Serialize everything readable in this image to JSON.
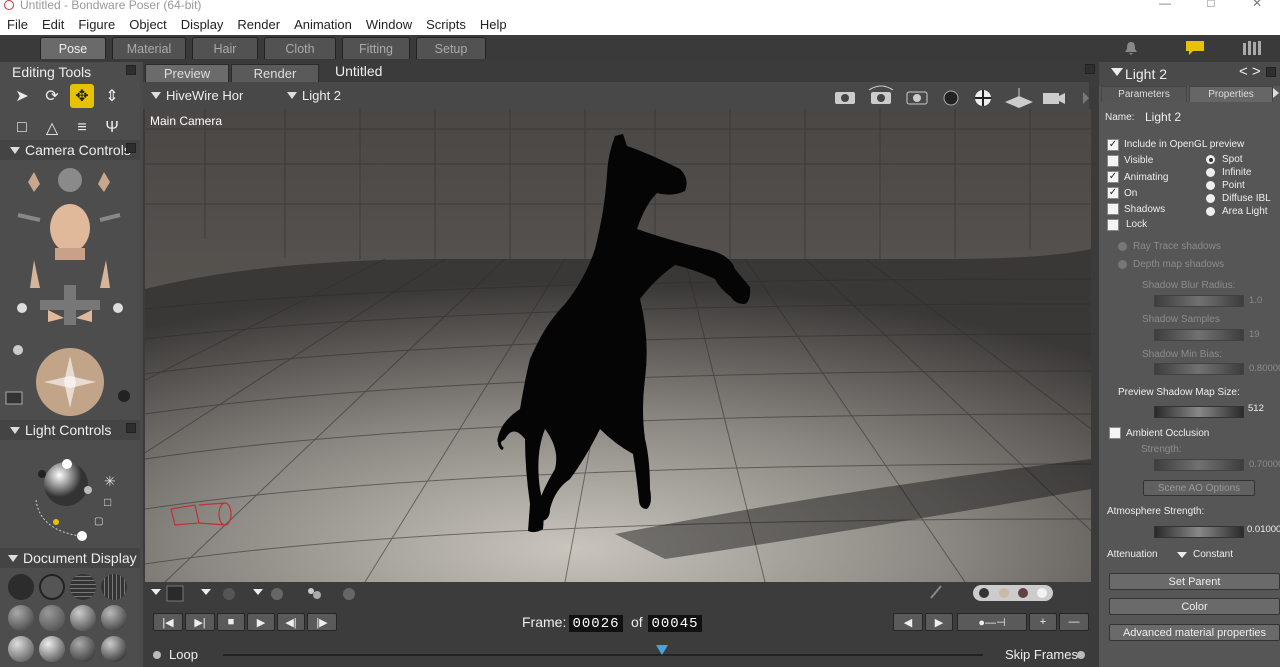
{
  "app": {
    "title": "Untitled - Bondware Poser (64-bit)"
  },
  "menu": [
    "File",
    "Edit",
    "Figure",
    "Object",
    "Display",
    "Render",
    "Animation",
    "Window",
    "Scripts",
    "Help"
  ],
  "room_tabs": [
    "Pose",
    "Material",
    "Hair",
    "Cloth",
    "Fitting",
    "Setup"
  ],
  "left": {
    "editing_tools": "Editing Tools",
    "camera_controls": "Camera Controls",
    "light_controls": "Light Controls",
    "document_display": "Document  Display"
  },
  "document": {
    "tabs": [
      "Preview",
      "Render"
    ],
    "title": "Untitled",
    "figure_select": "HiveWire Hor",
    "actor_select": "Light 2",
    "camera_label": "Main Camera"
  },
  "timeline": {
    "frame_label": "Frame:",
    "current": "00026",
    "of_label": "of",
    "total": "00045",
    "loop": "Loop",
    "skip_frames": "Skip Frames"
  },
  "right": {
    "header": "Light 2",
    "tabs": [
      "Parameters",
      "Properties"
    ],
    "name_label": "Name:",
    "name_value": "Light 2",
    "checks": [
      {
        "label": "Include in OpenGL preview",
        "checked": true
      },
      {
        "label": "Visible",
        "checked": false
      },
      {
        "label": "Animating",
        "checked": true
      },
      {
        "label": "On",
        "checked": true
      },
      {
        "label": "Shadows",
        "checked": false
      },
      {
        "label": "Lock",
        "checked": false
      }
    ],
    "types": [
      {
        "label": "Spot",
        "selected": true
      },
      {
        "label": "Infinite",
        "selected": false
      },
      {
        "label": "Point",
        "selected": false
      },
      {
        "label": "Diffuse IBL",
        "selected": false
      },
      {
        "label": "Area Light",
        "selected": false
      }
    ],
    "ray_trace": "Ray Trace shadows",
    "depth_map": "Depth map shadows",
    "shadow_blur": {
      "label": "Shadow Blur Radius:",
      "value": "1.0"
    },
    "shadow_samples": {
      "label": "Shadow Samples",
      "value": "19"
    },
    "shadow_min_bias": {
      "label": "Shadow Min Bias:",
      "value": "0.80000"
    },
    "preview_shadow": {
      "label": "Preview Shadow Map Size:",
      "value": "512"
    },
    "ambient_occlusion": "Ambient Occlusion",
    "strength": {
      "label": "Strength:",
      "value": "0.70000"
    },
    "scene_ao": "Scene AO Options",
    "atmosphere": {
      "label": "Atmosphere Strength:",
      "value": "0.01000"
    },
    "attenuation_label": "Attenuation",
    "attenuation_value": "Constant",
    "set_parent": "Set Parent",
    "color": "Color",
    "advanced": "Advanced material properties"
  },
  "colors": {
    "accent": "#e6c200",
    "viewport_floor": "#8a8782"
  }
}
